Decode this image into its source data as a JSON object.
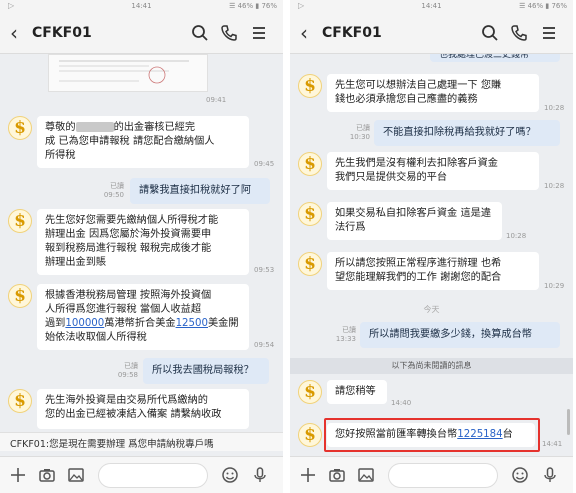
{
  "status_time": "14:41",
  "status_right_left": "🔕 ☰ 46% ▮ 76%",
  "status_right_right": "☰ 46% ▮ 76%",
  "contact_name": "CFKF01",
  "avatar_glyph": "$",
  "left": {
    "ts_top": "09:41",
    "m1": "尊敬的",
    "m1_tail": "的出金審核已經完\n成 已為您申請報稅 請您配合繳納個人\n所得稅",
    "m1_ts": "09:45",
    "r1": "已讀\n09:50",
    "o1": "請繫我直接扣稅就好了阿",
    "m2": "先生您好您需要先繳納個人所得稅才能\n辦理出金 因爲您屬於海外投資需要申\n報到稅務局進行報稅 報稅完成後才能\n辦理出金到賬",
    "m2_ts": "09:53",
    "m3_a": "根據香港稅務局管理 按照海外投資個\n人所得爲您進行報稅 當個人收益超\n過到",
    "m3_link1": "100000",
    "m3_b": "萬港幣折合美金",
    "m3_link2": "12500",
    "m3_c": "美金開\n始依法收取個人所得稅",
    "m3_ts": "09:54",
    "r2": "已讀\n09:58",
    "o2": "所以我去國稅局報稅？",
    "m4": "先生海外投資是由交易所代爲繳納的\n您的出金已經被凍結入備案 請繫納收政",
    "notice": "CFKF01:您是現在需要辦理 爲您申請納稅專戶嗎"
  },
  "right": {
    "top_partial": "也我處理已渡三史錢幣",
    "m1": "先生您可以想辦法自己處理一下 您賺\n錢也必須承擔您自己應盡的義務",
    "m1_ts": "10:28",
    "r1": "已讀\n10:30",
    "o1": "不能直接扣除稅再給我就好了嗎？",
    "m2": "先生我們是沒有權利去扣除客戶資金\n我們只是提供交易的平台",
    "m2_ts": "10:28",
    "m3": "如果交易私自扣除客戶資金 這是違\n法行爲",
    "m3_ts": "10:28",
    "m4": "所以請您按照正常程序進行辦理 也希\n望您能理解我們的工作 謝謝您的配合",
    "m4_ts": "10:29",
    "divider": "今天",
    "r2": "已讀\n13:33",
    "o2": "所以請問我要繳多少錢，換算成台幣",
    "newmsg": "以下為尚未閱讀的訊息",
    "m5": "請您稍等",
    "m5_ts": "14:40",
    "m6_a": "您好按照當前匯率轉換台幣",
    "m6_link": "1225184",
    "m6_b": "台",
    "m6_ts": "14:41"
  },
  "colors": {
    "accent_highlight": "#e5322d",
    "outgoing_bubble": "#dfe9f6",
    "link": "#2a63c8"
  }
}
